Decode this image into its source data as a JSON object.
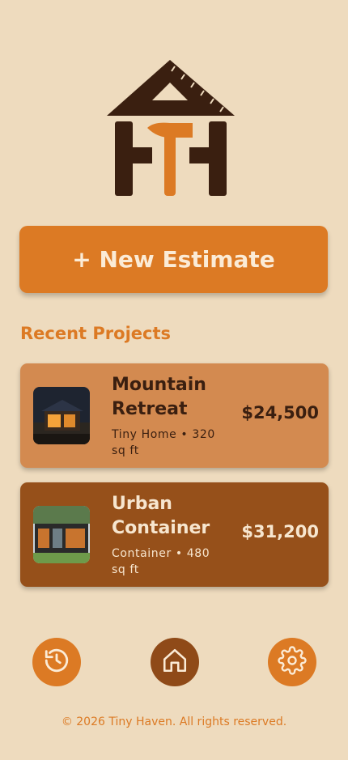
{
  "app": {
    "name": "Tiny Haven"
  },
  "actions": {
    "new_estimate_label": "+ New Estimate"
  },
  "recent": {
    "title": "Recent Projects",
    "projects": [
      {
        "name": "Mountain Retreat",
        "meta": "Tiny Home • 320 sq ft",
        "price": "$24,500"
      },
      {
        "name": "Urban Container",
        "meta": "Container • 480 sq ft",
        "price": "$31,200"
      }
    ]
  },
  "nav": {
    "items": [
      {
        "icon": "history-icon",
        "active": false
      },
      {
        "icon": "home-icon",
        "active": true
      },
      {
        "icon": "gear-icon",
        "active": false
      }
    ]
  },
  "footer": {
    "text": "© 2026 Tiny Haven. All rights reserved."
  },
  "colors": {
    "background": "#EEDBBE",
    "accent": "#DC7A24",
    "dark_brown": "#3A1F10",
    "card_light": "#D38A50",
    "card_dark": "#96501A"
  }
}
